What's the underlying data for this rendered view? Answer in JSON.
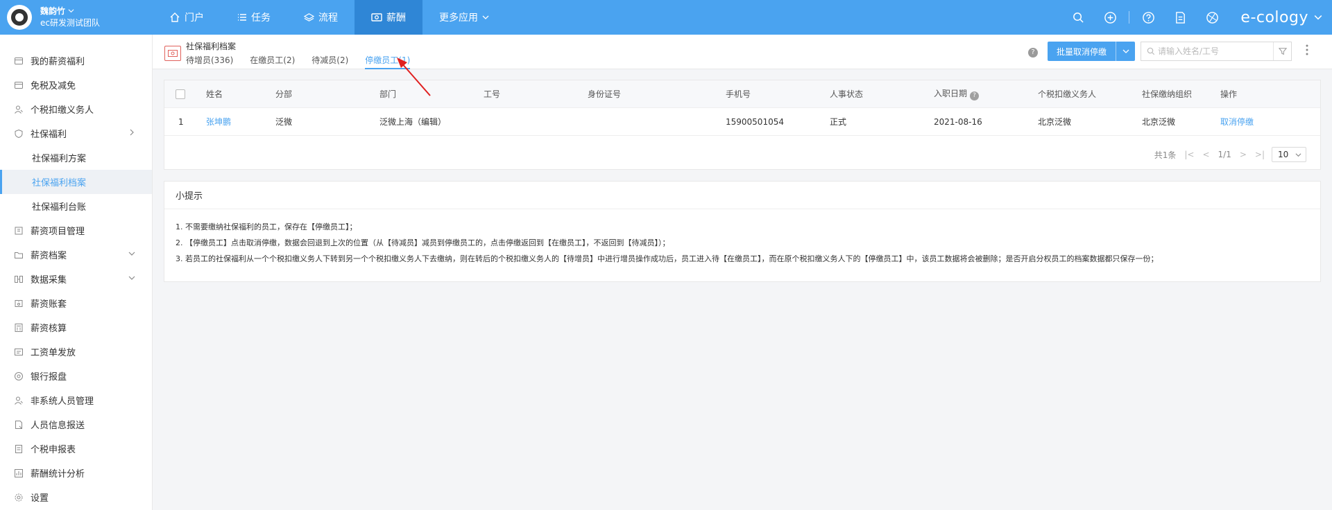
{
  "brand": {
    "user_name": "魏韵竹",
    "team": "ec研发测试团队"
  },
  "nav": [
    {
      "label": "门户",
      "icon": "home-icon"
    },
    {
      "label": "任务",
      "icon": "list-icon"
    },
    {
      "label": "流程",
      "icon": "layers-icon"
    },
    {
      "label": "薪酬",
      "icon": "money-icon",
      "active": true
    },
    {
      "label": "更多应用",
      "icon": "chevron-down-icon"
    }
  ],
  "logo_text": "e-cology",
  "sidebar": {
    "items": [
      {
        "label": "我的薪资福利",
        "icon": "wallet-icon"
      },
      {
        "label": "免税及减免",
        "icon": "wallet-icon"
      },
      {
        "label": "个税扣缴义务人",
        "icon": "user-icon"
      },
      {
        "label": "社保福利",
        "icon": "shield-icon",
        "caret": "chevron-right-icon"
      },
      {
        "label": "社保福利方案",
        "sub": true
      },
      {
        "label": "社保福利档案",
        "sub": true,
        "active": true
      },
      {
        "label": "社保福利台账",
        "sub": true
      },
      {
        "label": "薪资项目管理",
        "icon": "grid-icon"
      },
      {
        "label": "薪资档案",
        "icon": "folder-icon",
        "caret": "chevron-down-icon"
      },
      {
        "label": "数据采集",
        "icon": "collect-icon",
        "caret": "chevron-down-icon"
      },
      {
        "label": "薪资账套",
        "icon": "book-icon"
      },
      {
        "label": "薪资核算",
        "icon": "calculator-icon"
      },
      {
        "label": "工资单发放",
        "icon": "send-icon"
      },
      {
        "label": "银行报盘",
        "icon": "at-icon"
      },
      {
        "label": "非系统人员管理",
        "icon": "user-icon"
      },
      {
        "label": "人员信息报送",
        "icon": "report-icon"
      },
      {
        "label": "个税申报表",
        "icon": "doc-icon"
      },
      {
        "label": "薪酬统计分析",
        "icon": "chart-icon"
      },
      {
        "label": "设置",
        "icon": "gear-icon"
      }
    ]
  },
  "page": {
    "title": "社保福利档案",
    "tabs": [
      {
        "label": "待增员(336)"
      },
      {
        "label": "在缴员工(2)"
      },
      {
        "label": "待减员(2)"
      },
      {
        "label": "停缴员工(1)",
        "active": true
      }
    ],
    "help": "?",
    "batch_button": "批量取消停缴",
    "search_placeholder": "请输入姓名/工号"
  },
  "table": {
    "headers": [
      "姓名",
      "分部",
      "部门",
      "工号",
      "身份证号",
      "手机号",
      "人事状态",
      "入职日期",
      "个税扣缴义务人",
      "社保缴纳组织",
      "操作"
    ],
    "rows": [
      {
        "index": "1",
        "name": "张坤鹏",
        "branch": "泛微",
        "dept": "泛微上海（编辑）",
        "emp_no": "",
        "id_no": "",
        "phone": "15900501054",
        "status": "正式",
        "hire_date": "2021-08-16",
        "tax_agent": "北京泛微",
        "org": "北京泛微",
        "action": "取消停缴"
      }
    ],
    "pager": {
      "total": "共1条",
      "page": "1/1",
      "page_size": "10"
    }
  },
  "tips": {
    "title": "小提示",
    "lines": [
      "1. 不需要缴纳社保福利的员工，保存在【停缴员工】；",
      "2. 【停缴员工】点击取消停缴，数据会回退到上次的位置（从【待减员】减员到停缴员工的，点击停缴返回到【在缴员工】，不返回到【待减员】）；",
      "3. 若员工的社保福利从一个个税扣缴义务人下转到另一个个税扣缴义务人下去缴纳，则在转后的个税扣缴义务人的【待增员】中进行增员操作成功后，员工进入待【在缴员工】，而在原个税扣缴义务人下的【停缴员工】中，该员工数据将会被删除；是否开启分权员工的档案数据都只保存一份；"
    ]
  },
  "colors": {
    "primary": "#4aa3f0",
    "nav_active": "#2f86d6",
    "annotation": "#e02020"
  }
}
